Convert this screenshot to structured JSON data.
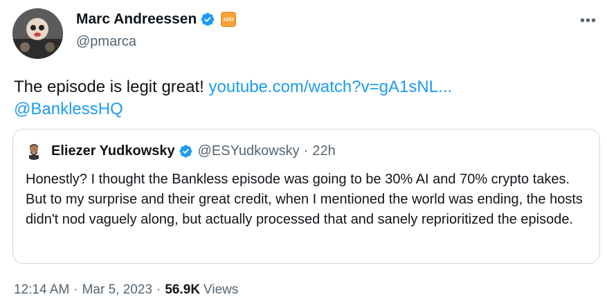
{
  "author": {
    "name": "Marc Andreessen",
    "handle": "@pmarca",
    "org_badge": "a16z",
    "verified": true,
    "avatar_icon": "profile-photo"
  },
  "more_icon": "more-horizontal-icon",
  "tweet": {
    "text": "The episode is legit great! ",
    "link": "youtube.com/watch?v=gA1sNL...",
    "mention": "@BanklessHQ"
  },
  "quoted": {
    "name": "Eliezer Yudkowsky",
    "handle": "@ESYudkowsky",
    "separator": "·",
    "time": "22h",
    "verified": true,
    "text": "Honestly?  I thought the Bankless episode was going to be 30% AI and 70% crypto takes.  But to my surprise and their great credit, when I mentioned the world was ending, the hosts didn't nod vaguely along, but actually processed that and sanely reprioritized the episode."
  },
  "meta": {
    "time": "12:14 AM",
    "separator": "·",
    "date": "Mar 5, 2023",
    "views_count": "56.9K",
    "views_label": "Views"
  },
  "colors": {
    "link": "#1d9bf0",
    "secondary_text": "#536471",
    "primary_text": "#0f1419",
    "border": "#cfd9de",
    "verified_blue": "#1d9bf0",
    "badge_orange": "#f7a23b"
  }
}
